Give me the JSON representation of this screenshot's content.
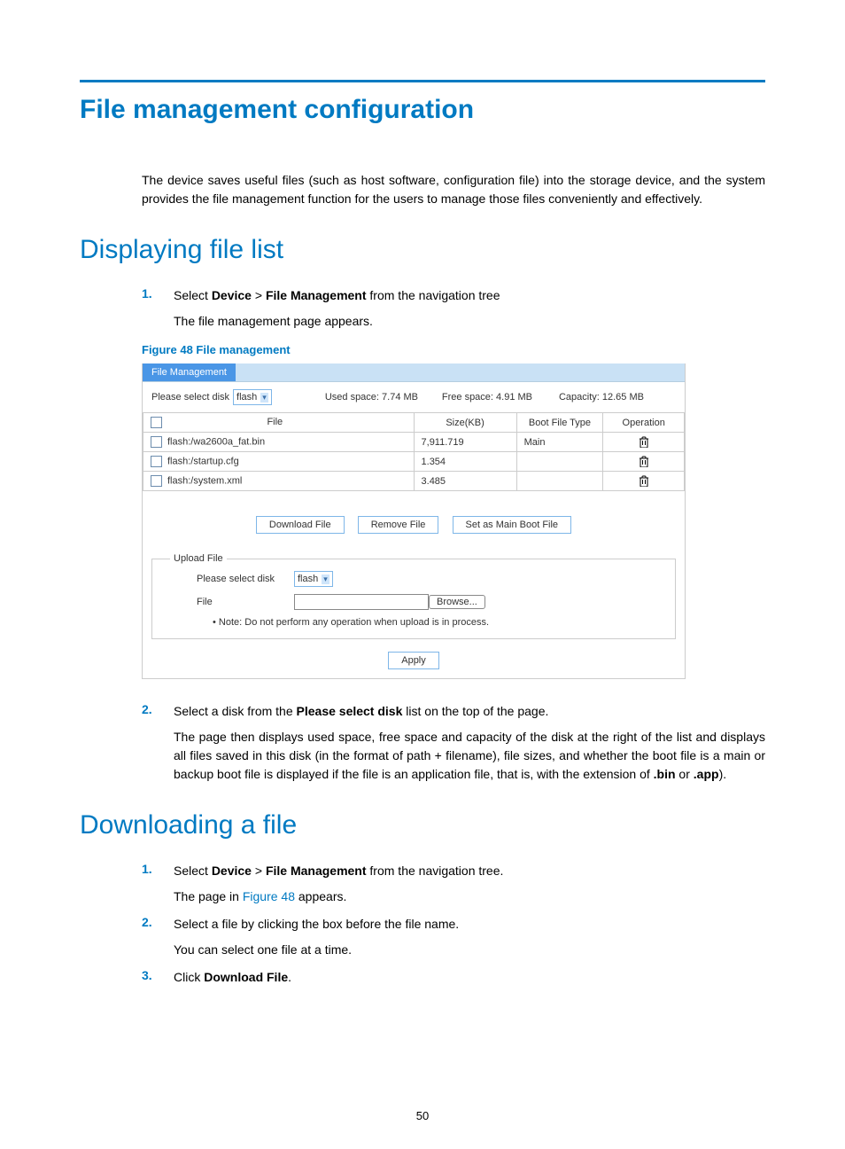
{
  "title": "File management configuration",
  "intro": "The device saves useful files (such as host software, configuration file) into the storage device, and the system provides the file management function for the users to manage those files conveniently and effectively.",
  "section_display_title": "Displaying file list",
  "figure_caption": "Figure 48 File management",
  "step1_num": "1.",
  "step1_a": "Select ",
  "step1_b": "Device",
  "step1_c": " > ",
  "step1_d": "File Management",
  "step1_e": " from the navigation tree",
  "step1_sub": "The file management page appears.",
  "screenshot": {
    "tab": "File Management",
    "select_label": "Please select disk",
    "disk": "flash",
    "used": "Used space: 7.74 MB",
    "free": "Free space: 4.91 MB",
    "capacity": "Capacity: 12.65 MB",
    "col_file": "File",
    "col_size": "Size(KB)",
    "col_boot": "Boot File Type",
    "col_op": "Operation",
    "rows": [
      {
        "file": "flash:/wa2600a_fat.bin",
        "size": "7,911.719",
        "boot": "Main"
      },
      {
        "file": "flash:/startup.cfg",
        "size": "1.354",
        "boot": ""
      },
      {
        "file": "flash:/system.xml",
        "size": "3.485",
        "boot": ""
      }
    ],
    "btn_download": "Download File",
    "btn_remove": "Remove File",
    "btn_setboot": "Set as Main Boot File",
    "upload_legend": "Upload File",
    "upload_select_label": "Please select disk",
    "upload_disk": "flash",
    "upload_file_label": "File",
    "browse": "Browse...",
    "note": "Note: Do not perform any operation when upload is in process.",
    "apply": "Apply"
  },
  "step2_num": "2.",
  "step2_a": "Select a disk from the ",
  "step2_b": "Please select disk",
  "step2_c": " list on the top of the page.",
  "step2_sub_a": "The page then displays used space, free space and capacity of the disk at the right of the list and displays all files saved in this disk (in the format of path + filename), file sizes, and whether the boot file is a main or backup boot file is displayed if the file is an application file, that is, with the extension of ",
  "step2_sub_b": ".bin",
  "step2_sub_c": " or ",
  "step2_sub_d": ".app",
  "step2_sub_e": ").",
  "section_download_title": "Downloading a file",
  "d1_num": "1.",
  "d1_a": "Select ",
  "d1_b": "Device",
  "d1_c": " > ",
  "d1_d": "File Management",
  "d1_e": " from the navigation tree.",
  "d1_sub_a": "The page in ",
  "d1_sub_b": "Figure 48",
  "d1_sub_c": " appears.",
  "d2_num": "2.",
  "d2_text": "Select a file by clicking the box before the file name.",
  "d2_sub": "You can select one file at a time.",
  "d3_num": "3.",
  "d3_a": "Click ",
  "d3_b": "Download File",
  "d3_c": ".",
  "pagenum": "50"
}
